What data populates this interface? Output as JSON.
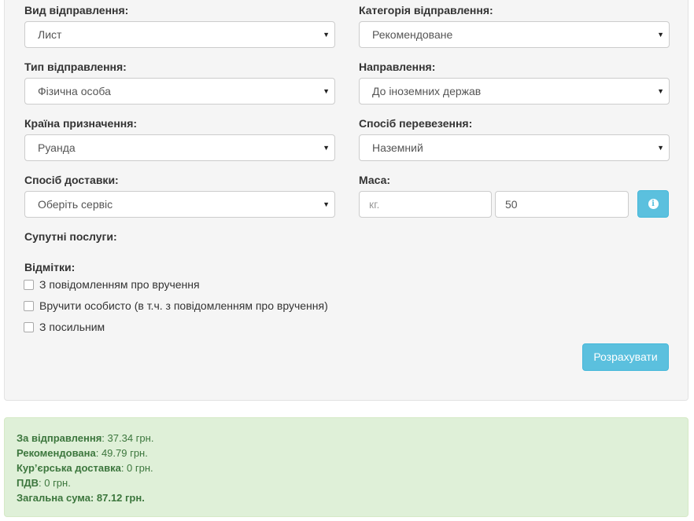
{
  "form": {
    "shipment_type": {
      "label": "Вид відправлення:",
      "value": "Лист"
    },
    "shipment_category": {
      "label": "Категорія відправлення:",
      "value": "Рекомендоване"
    },
    "sender_type": {
      "label": "Тип відправлення:",
      "value": "Фізична особа"
    },
    "direction": {
      "label": "Направлення:",
      "value": "До іноземних держав"
    },
    "destination_country": {
      "label": "Країна призначення:",
      "value": "Руанда"
    },
    "transport_method": {
      "label": "Спосіб перевезення:",
      "value": "Наземний"
    },
    "delivery_method": {
      "label": "Спосіб доставки:",
      "value": "Оберіть сервіс"
    },
    "weight": {
      "label": "Маса:",
      "unit_placeholder": "кг.",
      "value": "50"
    },
    "related_services": {
      "label": "Супутні послуги:"
    },
    "marks": {
      "label": "Відмітки:",
      "options": [
        "З повідомленням про вручення",
        "Вручити особисто (в т.ч. з повідомленням про вручення)",
        "З посильним"
      ]
    },
    "calculate_label": "Розрахувати"
  },
  "results": [
    {
      "label": "За відправлення",
      "value": ": 37.34 грн."
    },
    {
      "label": "Рекомендована",
      "value": ": 49.79 грн."
    },
    {
      "label": "Кур’єрська доставка",
      "value": ": 0 грн."
    },
    {
      "label": "ПДВ",
      "value": ": 0 грн."
    }
  ],
  "total": {
    "label": "Загальна сума: 87.12 грн."
  },
  "colors": {
    "info": "#5bc0de",
    "success_bg": "#dff0d8",
    "success_text": "#3c763d",
    "panel_bg": "#f5f5f5"
  },
  "icons": {
    "info_button": "info-circle-icon",
    "select_caret": "caret-down-icon"
  }
}
